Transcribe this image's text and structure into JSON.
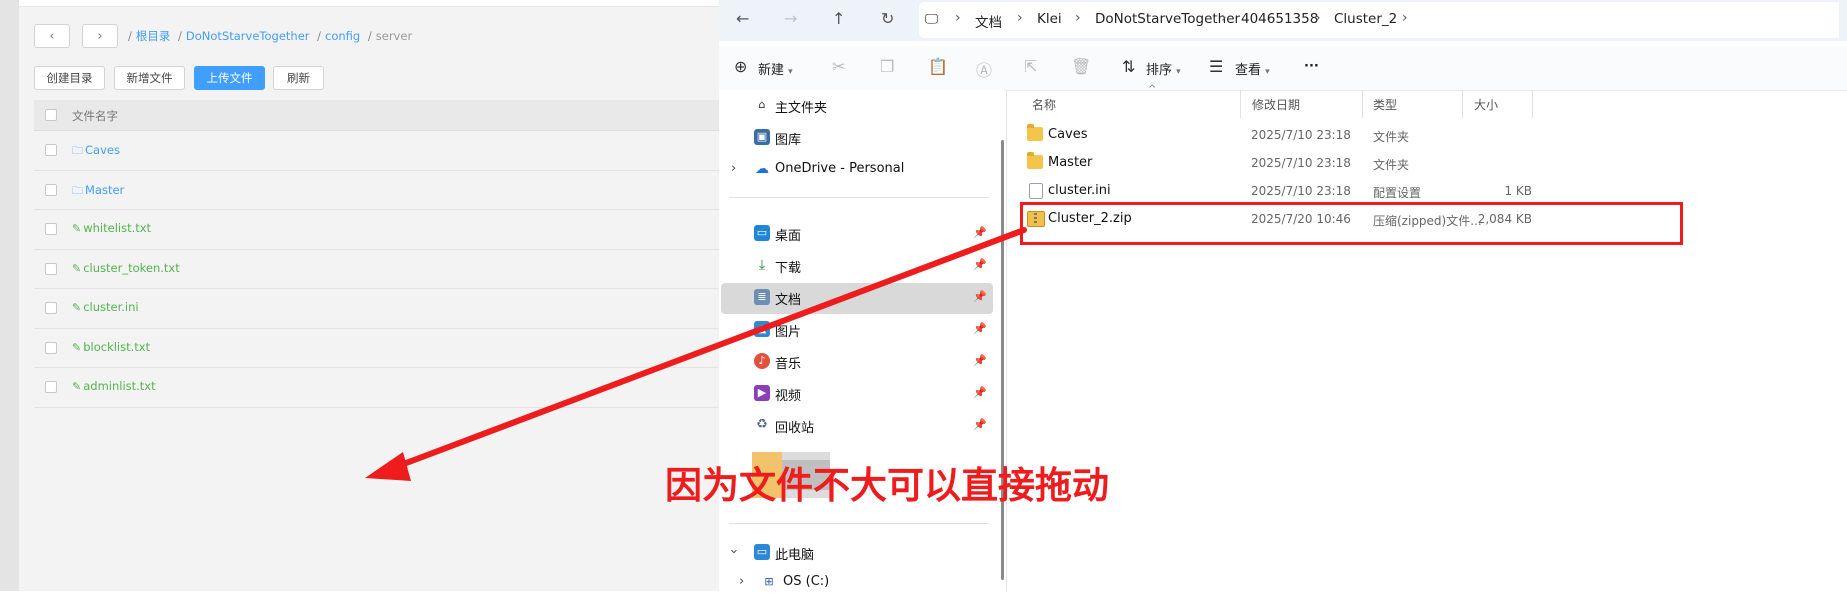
{
  "web": {
    "nav": {
      "back": "‹",
      "forward": "›"
    },
    "breadcrumb": [
      "根目录",
      "DoNotStarveTogether",
      "config",
      "server"
    ],
    "buttons": {
      "mkdir": "创建目录",
      "newfile": "新增文件",
      "upload": "上传文件",
      "refresh": "刷新"
    },
    "table_header": "文件名字",
    "files": [
      {
        "name": "Caves",
        "kind": "folder"
      },
      {
        "name": "Master",
        "kind": "folder"
      },
      {
        "name": "whitelist.txt",
        "kind": "file"
      },
      {
        "name": "cluster_token.txt",
        "kind": "file"
      },
      {
        "name": "cluster.ini",
        "kind": "file"
      },
      {
        "name": "blocklist.txt",
        "kind": "file"
      },
      {
        "name": "adminlist.txt",
        "kind": "file"
      }
    ],
    "colors": {
      "link": "#409eff",
      "file": "#52b54b",
      "primary": "#409eff"
    }
  },
  "explorer": {
    "address": [
      "文档",
      "Klei",
      "DoNotStarveTogether",
      "404651358",
      "Cluster_2"
    ],
    "toolbar": {
      "new": "新建",
      "sort": "排序",
      "view": "查看",
      "more": "···"
    },
    "nav": [
      {
        "label": "主文件夹",
        "icon": "home-icon"
      },
      {
        "label": "图库",
        "icon": "gallery-icon"
      },
      {
        "label": "OneDrive - Personal",
        "icon": "onedrive-icon"
      },
      {
        "label": "桌面",
        "icon": "desktop-icon"
      },
      {
        "label": "下载",
        "icon": "download-icon"
      },
      {
        "label": "文档",
        "icon": "documents-icon"
      },
      {
        "label": "图片",
        "icon": "pictures-icon"
      },
      {
        "label": "音乐",
        "icon": "music-icon"
      },
      {
        "label": "视频",
        "icon": "videos-icon"
      },
      {
        "label": "回收站",
        "icon": "recycle-bin-icon"
      },
      {
        "label": "此电脑",
        "icon": "this-pc-icon"
      },
      {
        "label": "OS (C:)",
        "icon": "drive-icon"
      }
    ],
    "columns": {
      "name": "名称",
      "date": "修改日期",
      "type": "类型",
      "size": "大小"
    },
    "files": [
      {
        "name": "Caves",
        "date": "2025/7/10 23:18",
        "type": "文件夹",
        "size": ""
      },
      {
        "name": "Master",
        "date": "2025/7/10 23:18",
        "type": "文件夹",
        "size": ""
      },
      {
        "name": "cluster.ini",
        "date": "2025/7/10 23:18",
        "type": "配置设置",
        "size": "1 KB"
      },
      {
        "name": "Cluster_2.zip",
        "date": "2025/7/20 10:46",
        "type": "压缩(zipped)文件...",
        "size": "2,084 KB"
      }
    ]
  },
  "annotation": {
    "text": "因为文件不大可以直接拖动",
    "color": "#ee1c1c"
  }
}
